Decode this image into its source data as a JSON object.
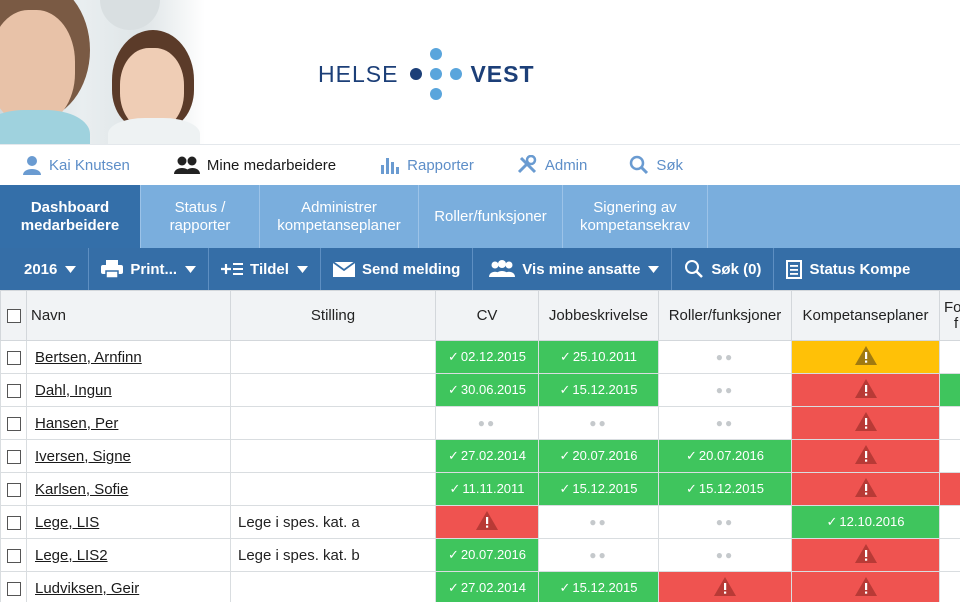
{
  "brand": {
    "word1": "HELSE",
    "word2": "VEST",
    "colors": {
      "navy": "#1c3f78",
      "light_blue": "#5aa5dc"
    }
  },
  "topnav": {
    "items": [
      {
        "label": "Kai Knutsen",
        "icon": "user-icon"
      },
      {
        "label": "Mine medarbeidere",
        "icon": "users-icon"
      },
      {
        "label": "Rapporter",
        "icon": "bar-chart-icon"
      },
      {
        "label": "Admin",
        "icon": "tools-icon"
      },
      {
        "label": "Søk",
        "icon": "search-icon"
      }
    ],
    "active": "Mine medarbeidere"
  },
  "tabs": [
    {
      "label": "Dashboard medarbeidere",
      "line1": "Dashboard",
      "line2": "medarbeidere"
    },
    {
      "label": "Status / rapporter",
      "line1": "Status /",
      "line2": "rapporter"
    },
    {
      "label": "Administrer kompetanseplaner",
      "line1": "Administrer",
      "line2": "kompetanseplaner"
    },
    {
      "label": "Roller/funksjoner",
      "line1": "Roller/funksjoner",
      "line2": ""
    },
    {
      "label": "Signering av kompetansekrav",
      "line1": "Signering av",
      "line2": "kompetansekrav"
    }
  ],
  "toolbar": {
    "year": "2016",
    "print": "Print...",
    "assign": "Tildel",
    "send": "Send melding",
    "show_employees": "Vis mine ansatte",
    "search": "Søk (0)",
    "status": "Status Kompe"
  },
  "grid": {
    "headers": [
      "Navn",
      "Stilling",
      "CV",
      "Jobbeskrivelse",
      "Roller/funksjoner",
      "Kompetanseplaner",
      "Fo",
      "f"
    ],
    "rows": [
      {
        "name": "Bertsen, Arnfinn",
        "stilling": "",
        "cv": "02.12.2015",
        "jobb": "25.10.2011",
        "roller": "",
        "plan": "warning-yellow",
        "extra": ""
      },
      {
        "name": "Dahl, Ingun",
        "stilling": "",
        "cv": "30.06.2015",
        "jobb": "15.12.2015",
        "roller": "",
        "plan": "warning-red",
        "extra": "green"
      },
      {
        "name": "Hansen, Per",
        "stilling": "",
        "cv": "",
        "jobb": "",
        "roller": "",
        "plan": "warning-red",
        "extra": ""
      },
      {
        "name": "Iversen, Signe",
        "stilling": "",
        "cv": "27.02.2014",
        "jobb": "20.07.2016",
        "roller": "20.07.2016",
        "plan": "warning-red",
        "extra": ""
      },
      {
        "name": "Karlsen, Sofie",
        "stilling": "",
        "cv": "11.11.2011",
        "jobb": "15.12.2015",
        "roller": "15.12.2015",
        "plan": "warning-red",
        "extra": "red"
      },
      {
        "name": "Lege, LIS",
        "stilling": "Lege i spes. kat. a",
        "cv": "warning-red",
        "jobb": "",
        "roller": "",
        "plan": "12.10.2016",
        "extra": ""
      },
      {
        "name": "Lege, LIS2",
        "stilling": "Lege i spes. kat. b",
        "cv": "20.07.2016",
        "jobb": "",
        "roller": "",
        "plan": "warning-red",
        "extra": ""
      },
      {
        "name": "Ludviksen, Geir",
        "stilling": "",
        "cv": "27.02.2014",
        "jobb": "15.12.2015",
        "roller": "warning-red",
        "plan": "warning-red",
        "extra": ""
      }
    ],
    "colors": {
      "green": "#3fc55d",
      "red": "#ef5350",
      "yellow": "#ffc107"
    }
  }
}
